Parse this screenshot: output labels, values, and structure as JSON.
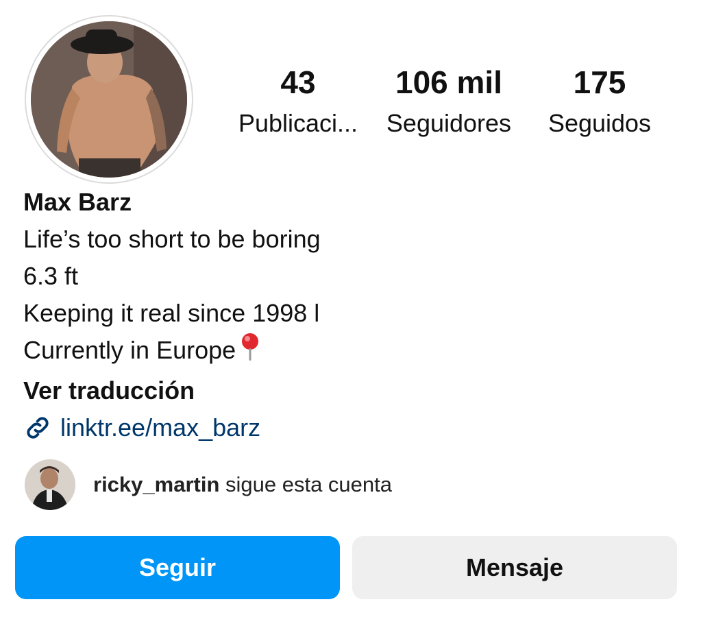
{
  "profile": {
    "name": "Max Barz",
    "bio_lines": [
      "Life’s too short to be boring",
      "6.3 ft",
      "Keeping it real since 1998 l",
      "Currently in Europe"
    ],
    "translate_label": "Ver traducción",
    "link_text": "linktr.ee/max_barz",
    "avatar_icon": "profile-photo",
    "pin_icon": "round-pushpin-icon"
  },
  "stats": {
    "posts": {
      "value": "43",
      "label": "Publicaci..."
    },
    "followers": {
      "value": "106 mil",
      "label": "Seguidores"
    },
    "following": {
      "value": "175",
      "label": "Seguidos"
    }
  },
  "mutual": {
    "username": "ricky_martin",
    "text": " sigue esta cuenta"
  },
  "actions": {
    "follow_label": "Seguir",
    "message_label": "Mensaje"
  },
  "colors": {
    "follow_button": "#0095f6",
    "message_button": "#efefef",
    "link": "#00376b"
  }
}
